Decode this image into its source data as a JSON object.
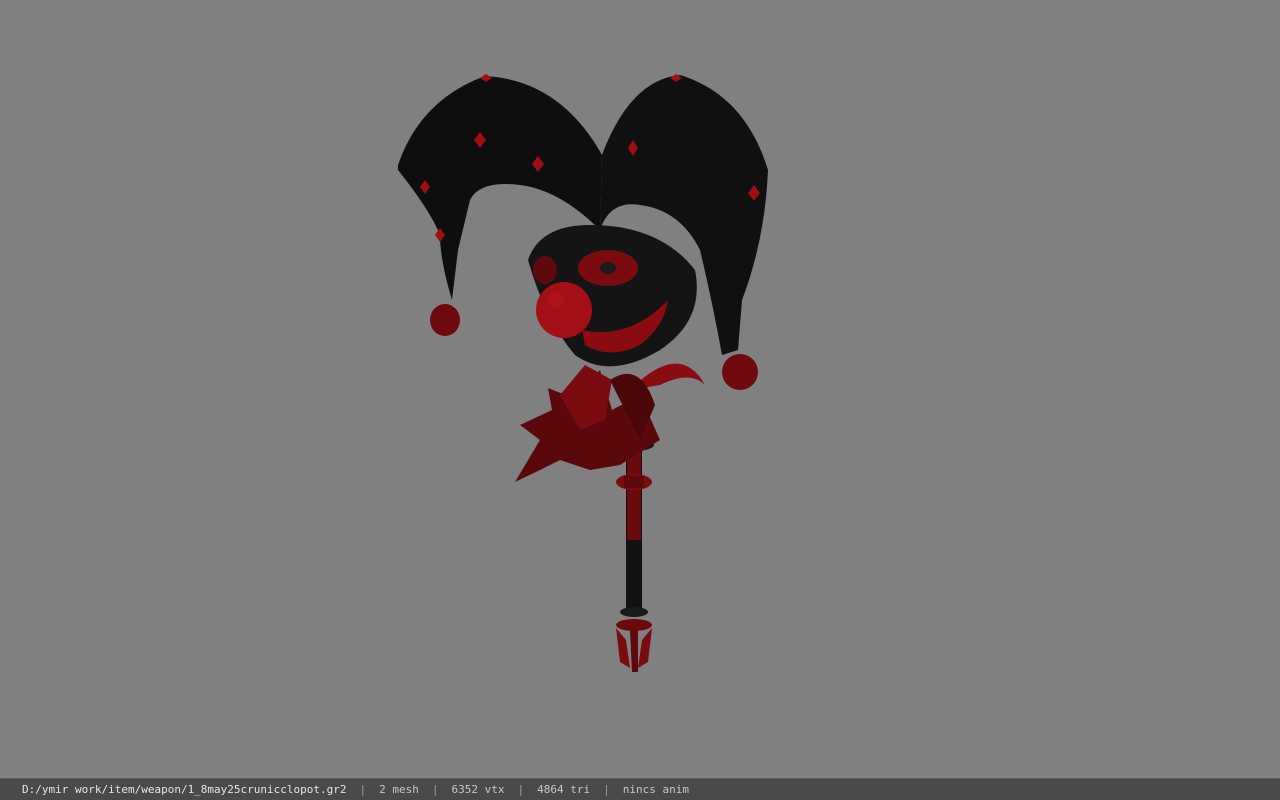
{
  "viewport": {
    "background_color": "#808080",
    "model": {
      "object": "jester-scepter-weapon",
      "primary_color": "#0e0e0e",
      "accent_color": "#8a0c10"
    }
  },
  "status_bar": {
    "file_path": "D:/ymir work/item/weapon/1_8may25crunicclopot.gr2",
    "mesh_count": "2 mesh",
    "vertex_count": "6352 vtx",
    "triangle_count": "4864 tri",
    "anim_status": "nincs anim",
    "separator": "|"
  }
}
